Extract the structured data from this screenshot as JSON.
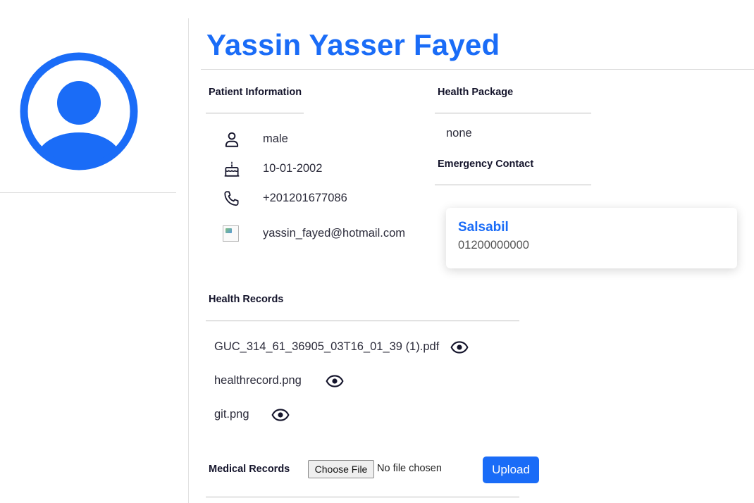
{
  "patient": {
    "name": "Yassin Yasser Fayed"
  },
  "sections": {
    "patient_info": "Patient Information",
    "health_package": "Health Package",
    "emergency_contact": "Emergency Contact",
    "health_records": "Health Records",
    "medical_records": "Medical Records"
  },
  "info": {
    "gender": "male",
    "dob": "10-01-2002",
    "phone": "+201201677086",
    "email": "yassin_fayed@hotmail.com"
  },
  "health_package": {
    "value": "none"
  },
  "emergency_contact": {
    "name": "Salsabil",
    "phone": "01200000000"
  },
  "records": [
    {
      "name": "GUC_314_61_36905_03T16_01_39 (1).pdf"
    },
    {
      "name": "healthrecord.png"
    },
    {
      "name": "git.png"
    }
  ],
  "upload": {
    "choose_label": "Choose File",
    "no_file": "No file chosen",
    "upload_label": "Upload"
  },
  "colors": {
    "accent": "#1a6cf7",
    "text": "#14142b"
  },
  "icons": {
    "avatar": "user-avatar-icon",
    "gender": "person-icon",
    "dob": "cake-icon",
    "phone": "phone-icon",
    "email": "broken-image-icon",
    "view": "eye-icon"
  }
}
